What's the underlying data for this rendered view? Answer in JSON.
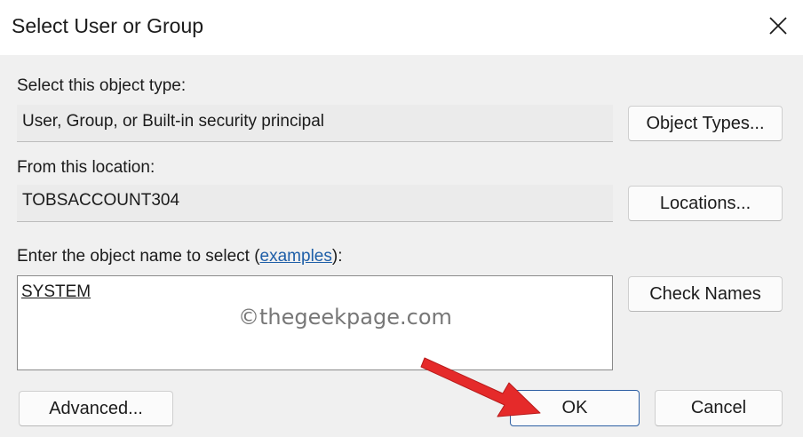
{
  "dialog": {
    "title": "Select User or Group",
    "close_icon": "close-icon"
  },
  "object_type": {
    "label": "Select this object type:",
    "value": "User, Group, or Built-in security principal",
    "button_label": "Object Types..."
  },
  "location": {
    "label": "From this location:",
    "value": "TOBSACCOUNT304",
    "button_label": "Locations..."
  },
  "object_name": {
    "label_prefix": "Enter the object name to select (",
    "label_link": "examples",
    "label_suffix": "):",
    "value": "SYSTEM",
    "check_names_label": "Check Names"
  },
  "footer": {
    "advanced_label": "Advanced...",
    "ok_label": "OK",
    "cancel_label": "Cancel"
  },
  "watermark": "©thegeekpage.com",
  "colors": {
    "accent": "#2d5fa3",
    "arrow": "#e52a2a",
    "link": "#1f5fa8"
  }
}
